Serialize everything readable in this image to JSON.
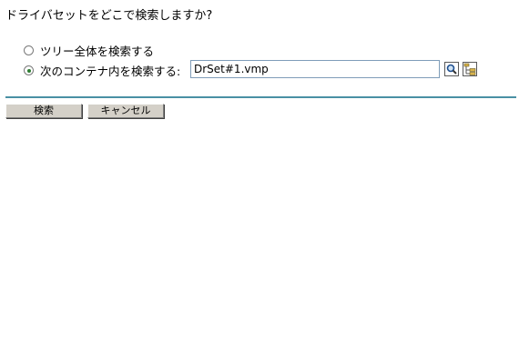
{
  "question": "ドライバセットをどこで検索しますか?",
  "options": [
    {
      "label": "ツリー全体を検索する",
      "selected": false
    },
    {
      "label": "次のコンテナ内を検索する:",
      "selected": true
    }
  ],
  "context_field": {
    "value": "DrSet#1.vmp"
  },
  "icons": {
    "search": "magnifier-icon",
    "browse": "tree-browser-icon"
  },
  "buttons": {
    "search_label": "検索",
    "cancel_label": "キャンセル"
  },
  "colors": {
    "accent_rule": "#4a90a4",
    "radio_dot": "#2e7d32"
  }
}
